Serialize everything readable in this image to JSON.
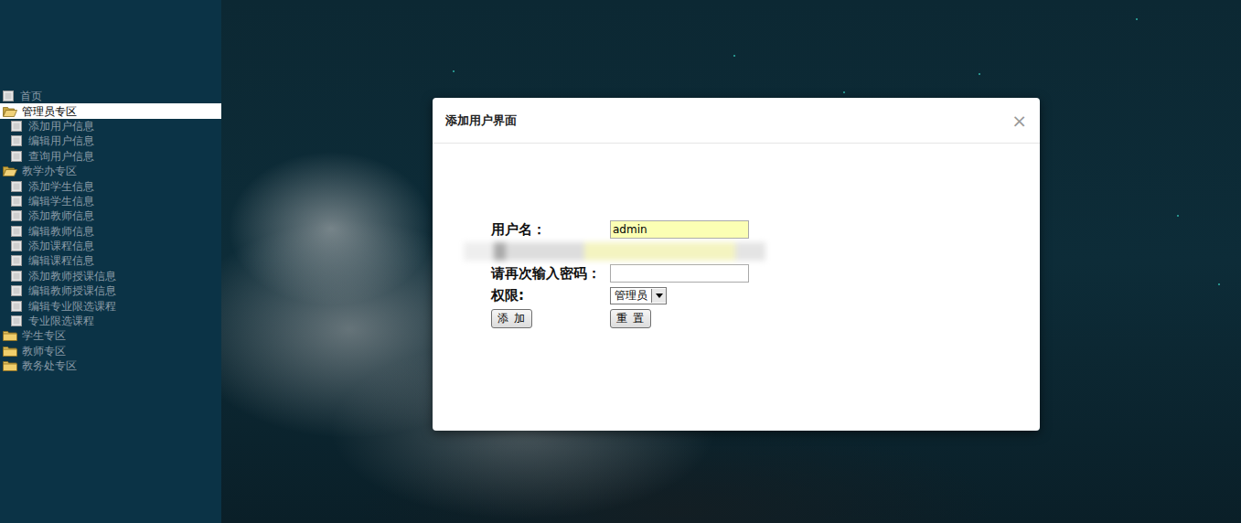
{
  "sidebar": {
    "items": [
      {
        "label": "首页",
        "kind": "page",
        "selected": false
      },
      {
        "label": "管理员专区",
        "kind": "folder",
        "expanded": true,
        "selected": true,
        "children": [
          {
            "label": "添加用户信息",
            "selected": false
          },
          {
            "label": "编辑用户信息",
            "selected": false
          },
          {
            "label": "查询用户信息",
            "selected": false
          }
        ]
      },
      {
        "label": "教学办专区",
        "kind": "folder",
        "expanded": true,
        "selected": false,
        "children": [
          {
            "label": "添加学生信息",
            "selected": false
          },
          {
            "label": "编辑学生信息",
            "selected": false
          },
          {
            "label": "添加教师信息",
            "selected": false
          },
          {
            "label": "编辑教师信息",
            "selected": false
          },
          {
            "label": "添加课程信息",
            "selected": false
          },
          {
            "label": "编辑课程信息",
            "selected": false
          },
          {
            "label": "添加教师授课信息",
            "selected": false
          },
          {
            "label": "编辑教师授课信息",
            "selected": false
          },
          {
            "label": "编辑专业限选课程",
            "selected": false
          },
          {
            "label": "专业限选课程",
            "selected": false
          }
        ]
      },
      {
        "label": "学生专区",
        "kind": "folder",
        "expanded": false,
        "selected": false,
        "children": []
      },
      {
        "label": "教师专区",
        "kind": "folder",
        "expanded": false,
        "selected": false,
        "children": []
      },
      {
        "label": "教务处专区",
        "kind": "folder",
        "expanded": false,
        "selected": false,
        "children": []
      }
    ]
  },
  "dialog": {
    "title": "添加用户界面",
    "close": "×",
    "fields": [
      {
        "kind": "text",
        "label": "用户名：",
        "value": "admin",
        "autofilled": true
      },
      {
        "kind": "obscured"
      },
      {
        "kind": "text",
        "label": "请再次输入密码：",
        "value": "",
        "autofilled": false
      },
      {
        "kind": "select",
        "label": "权限:",
        "value": "管理员"
      }
    ],
    "buttons": [
      "添 加",
      "重 置"
    ]
  }
}
